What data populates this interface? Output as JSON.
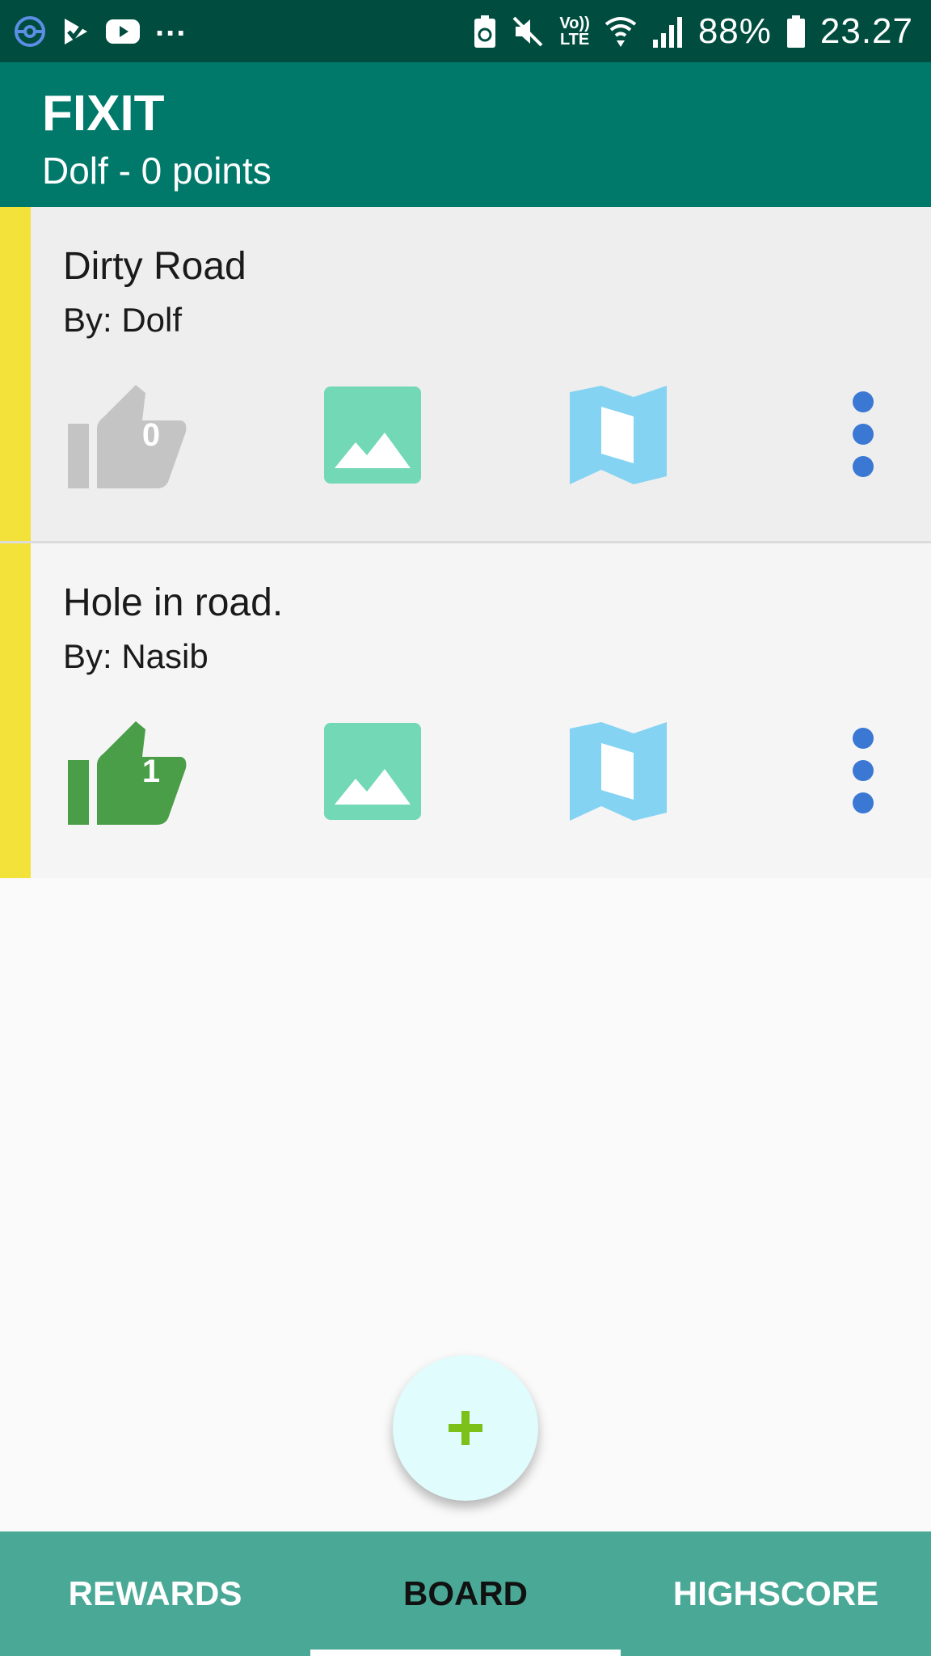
{
  "status_bar": {
    "left_icons": [
      "pokeball-icon",
      "check-icon",
      "youtube-icon"
    ],
    "overflow": "...",
    "right_icons": [
      "battery-saver-icon",
      "mute-icon",
      "volte-icon",
      "wifi-icon",
      "signal-icon"
    ],
    "volte_top": "Vo))",
    "volte_bottom": "LTE",
    "battery": "88%",
    "time": "23.27"
  },
  "app_bar": {
    "title": "FIXIT",
    "subtitle": "Dolf - 0 points"
  },
  "cards": [
    {
      "title": "Dirty Road",
      "author": "By: Dolf",
      "likes": "0",
      "liked": false
    },
    {
      "title": "Hole in road.",
      "author": "By: Nasib",
      "likes": "1",
      "liked": true
    }
  ],
  "fab": {
    "icon": "plus-icon"
  },
  "bottom_nav": {
    "tabs": [
      "REWARDS",
      "BOARD",
      "HIGHSCORE"
    ],
    "active": "BOARD"
  },
  "colors": {
    "status_bar": "#004d40",
    "app_bar": "#00796b",
    "bottom_nav": "#4aa996",
    "stripe": "#f3e23a",
    "like_inactive": "#c4c4c4",
    "like_active": "#4a9e47",
    "image_icon": "#72d8b6",
    "map_icon": "#84d3f2",
    "more_icon": "#3a78d4",
    "fab_plus": "#7cc11a"
  }
}
